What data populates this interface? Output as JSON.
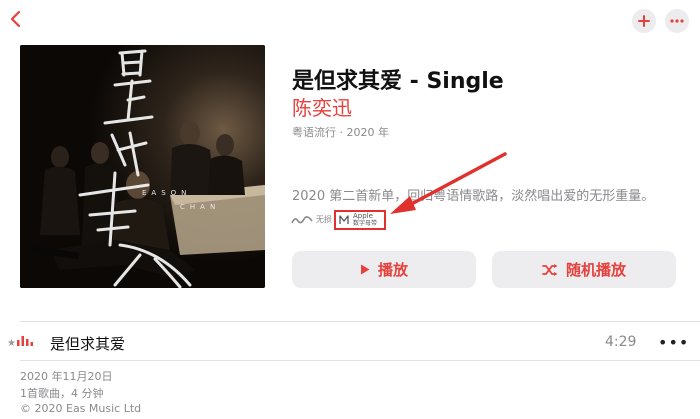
{
  "icons": {
    "back": "chevron-left-icon",
    "add": "plus-icon",
    "more": "ellipsis-icon",
    "play": "play-triangle-icon",
    "shuffle": "shuffle-icon",
    "lossless": "lossless-wave-icon",
    "digital_master": "digital-master-icon"
  },
  "colors": {
    "accent": "#e6413d",
    "badge_border": "#e0312d"
  },
  "album": {
    "title": "是但求其爱 - Single",
    "artist": "陈奕迅",
    "meta": "粤语流行 · 2020 年",
    "description": "2020 第二首新单，回归粤语情歌路，淡然唱出爱的无形重量。",
    "cover_text": {
      "calligraphy": "是但求其爱",
      "name_line1": "EASON",
      "name_line2": "CHAN"
    }
  },
  "badges": {
    "lossless_label": "无损",
    "digital_master_line1": "Apple",
    "digital_master_line2": "数字母带"
  },
  "actions": {
    "play_label": "播放",
    "shuffle_label": "随机播放"
  },
  "tracks": [
    {
      "title": "是但求其爱",
      "duration": "4:29",
      "more": "•••"
    }
  ],
  "footer": {
    "release_date": "2020 年11月20日",
    "summary": "1首歌曲，4 分钟",
    "copyright": "© 2020 Eas Music Ltd"
  }
}
